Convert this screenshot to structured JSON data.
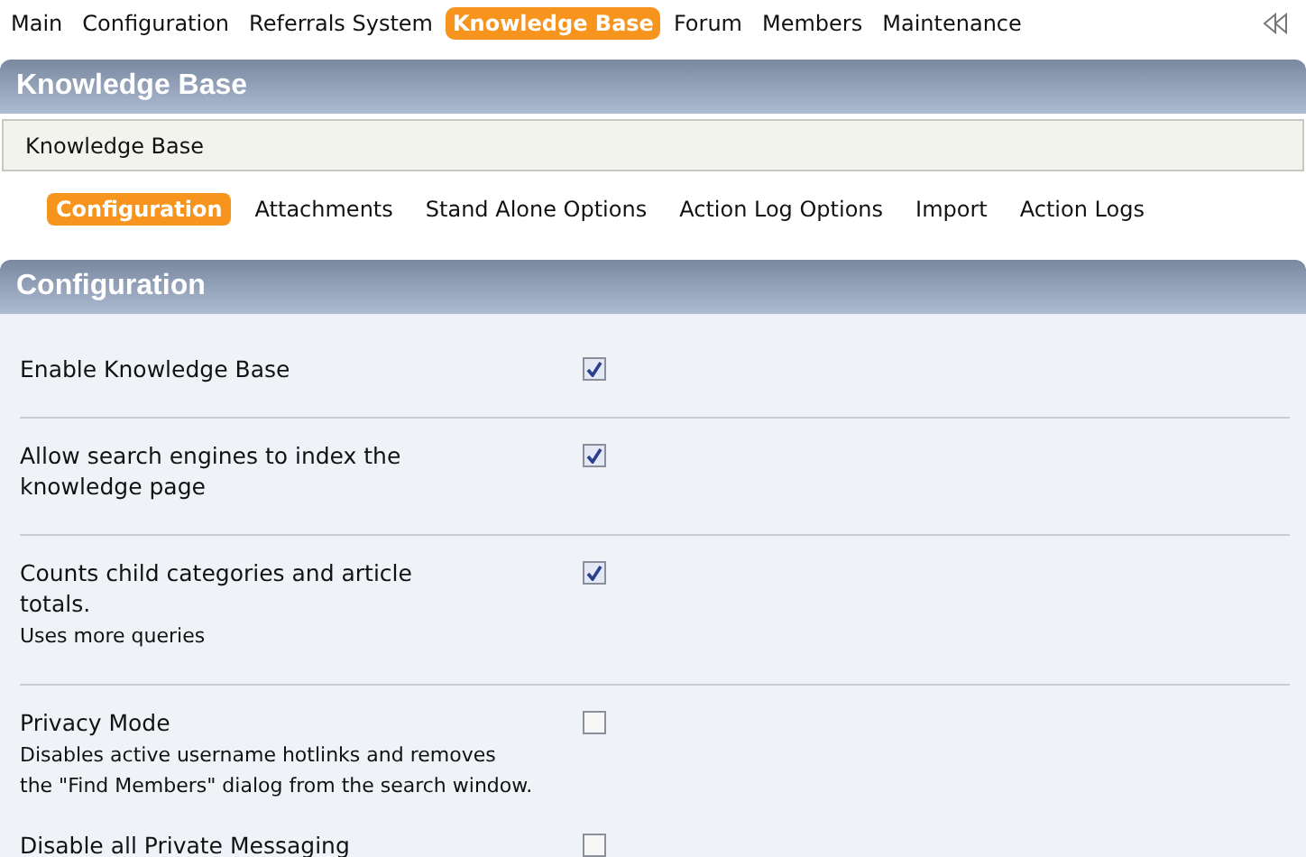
{
  "top_nav": [
    {
      "label": "Main",
      "selected": false
    },
    {
      "label": "Configuration",
      "selected": false
    },
    {
      "label": "Referrals System",
      "selected": false
    },
    {
      "label": "Knowledge Base",
      "selected": true
    },
    {
      "label": "Forum",
      "selected": false
    },
    {
      "label": "Members",
      "selected": false
    },
    {
      "label": "Maintenance",
      "selected": false
    }
  ],
  "page_header": {
    "title": "Knowledge Base"
  },
  "breadcrumb": "Knowledge Base",
  "sub_tabs": [
    {
      "label": "Configuration",
      "selected": true
    },
    {
      "label": "Attachments",
      "selected": false
    },
    {
      "label": "Stand Alone Options",
      "selected": false
    },
    {
      "label": "Action Log Options",
      "selected": false
    },
    {
      "label": "Import",
      "selected": false
    },
    {
      "label": "Action Logs",
      "selected": false
    }
  ],
  "section": {
    "title": "Configuration",
    "settings": [
      {
        "label": "Enable Knowledge Base",
        "checked": true
      },
      {
        "label": "Allow search engines to index the knowledge page",
        "checked": true
      },
      {
        "label": "Counts child categories and article totals.",
        "description": "Uses more queries",
        "checked": true
      },
      {
        "label": "Privacy Mode",
        "description": "Disables active username hotlinks and removes the \"Find Members\" dialog from the search window.",
        "checked": false
      },
      {
        "label": "Disable all Private Messaging",
        "checked": false
      }
    ]
  }
}
